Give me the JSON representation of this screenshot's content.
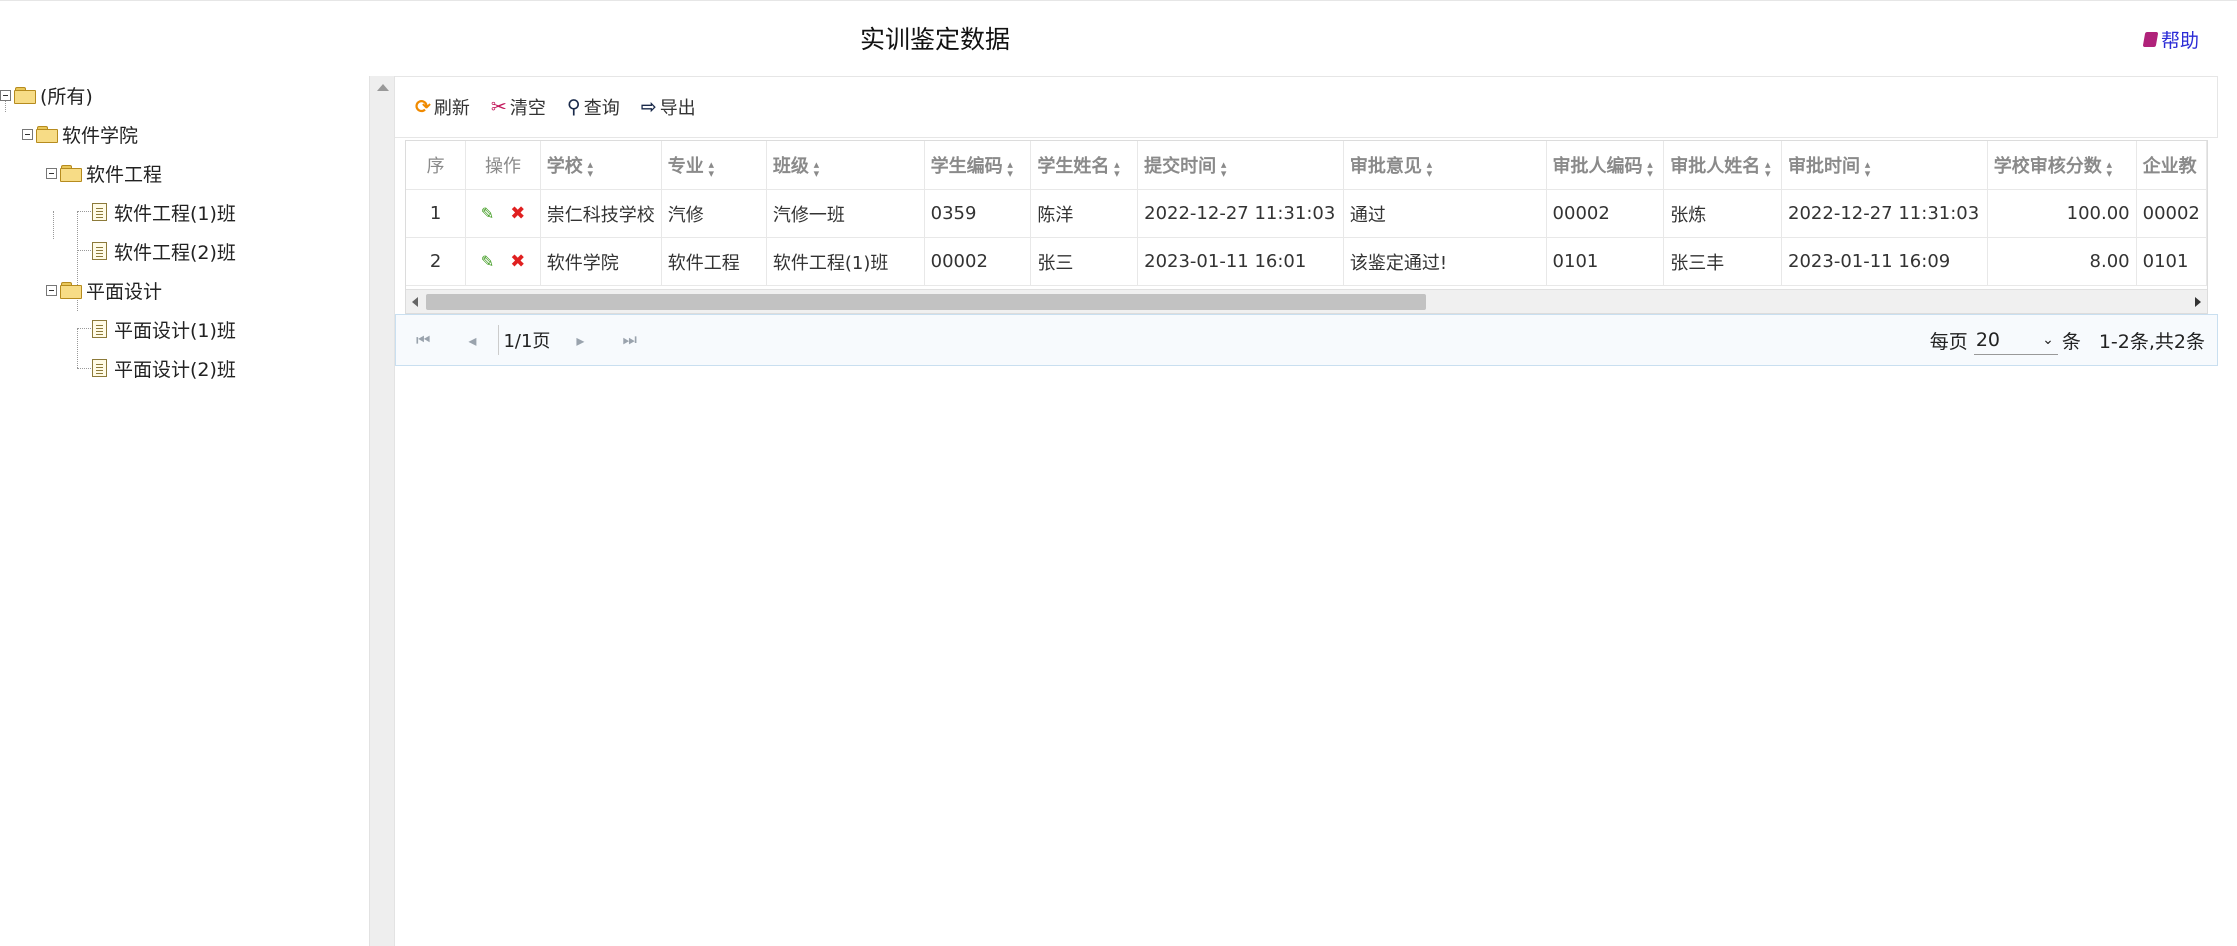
{
  "header": {
    "title": "实训鉴定数据",
    "help_label": "帮助"
  },
  "tree": {
    "root": "(所有)",
    "college": "软件学院",
    "majors": [
      {
        "label": "软件工程",
        "classes": [
          "软件工程(1)班",
          "软件工程(2)班"
        ]
      },
      {
        "label": "平面设计",
        "classes": [
          "平面设计(1)班",
          "平面设计(2)班"
        ]
      }
    ]
  },
  "toolbar": {
    "refresh": "刷新",
    "clear": "清空",
    "query": "查询",
    "export": "导出"
  },
  "table": {
    "columns": [
      "序",
      "操作",
      "学校",
      "专业",
      "班级",
      "学生编码",
      "学生姓名",
      "提交时间",
      "审批意见",
      "审批人编码",
      "审批人姓名",
      "审批时间",
      "学校审核分数",
      "企业教"
    ],
    "rows": [
      [
        "1",
        "崇仁科技学校",
        "汽修",
        "汽修一班",
        "0359",
        "陈洋",
        "2022-12-27 11:31:03",
        "通过",
        "00002",
        "张炼",
        "2022-12-27 11:31:03",
        "100.00",
        "00002"
      ],
      [
        "2",
        "软件学院",
        "软件工程",
        "软件工程(1)班",
        "00002",
        "张三",
        "2023-01-11 16:01",
        "该鉴定通过!",
        "0101",
        "张三丰",
        "2023-01-11 16:09",
        "8.00",
        "0101"
      ]
    ]
  },
  "pager": {
    "page_info": "1/1页",
    "per_page_prefix": "每页",
    "per_page_value": "20",
    "per_page_suffix": "条",
    "total": "1-2条,共2条"
  },
  "colors": {
    "accent_blue": "#2b2bd6",
    "edit_green": "#3d9a1e",
    "delete_red": "#e02020",
    "folder_yellow": "#f7dc86"
  }
}
